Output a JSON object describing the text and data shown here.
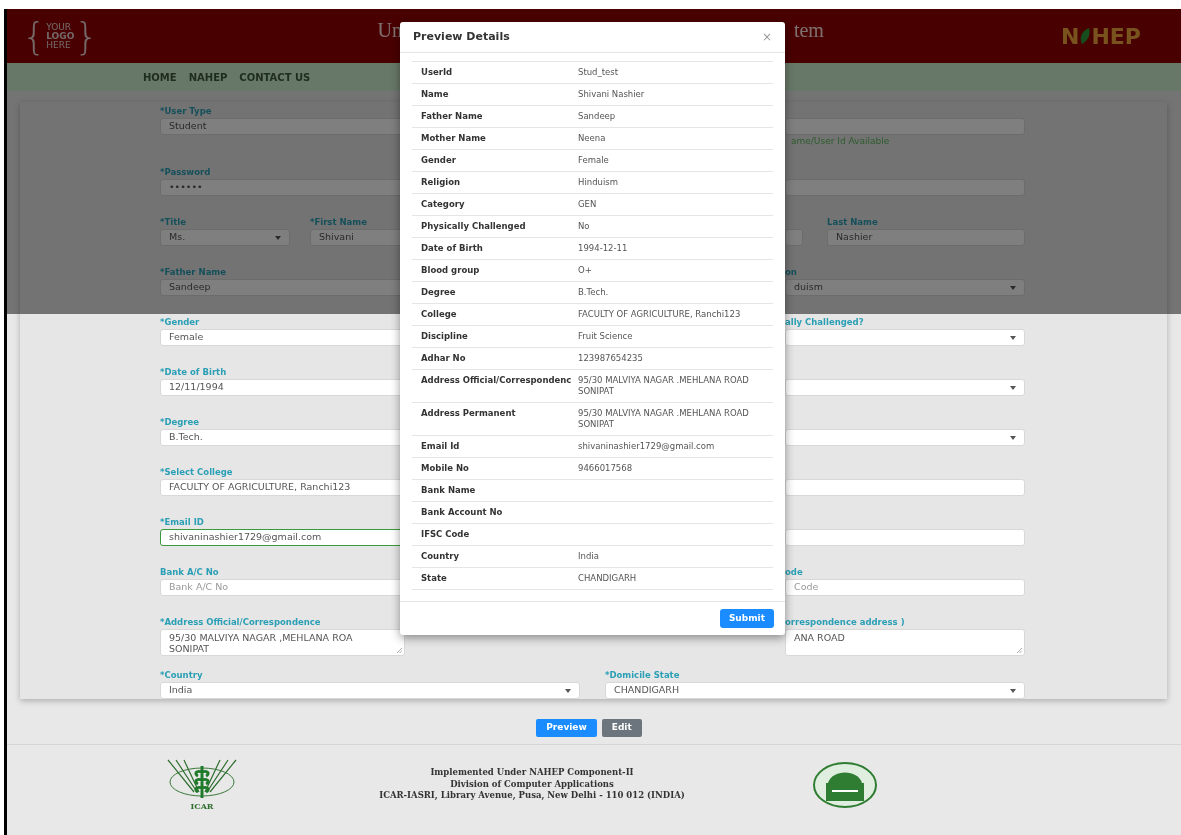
{
  "header": {
    "logo": {
      "open": "{",
      "lines": [
        "YOUR",
        "LOGO",
        "HERE"
      ],
      "close": "}"
    },
    "title_parts": [
      "Un",
      "tem"
    ],
    "brand": [
      "N",
      "HEP"
    ]
  },
  "nav": [
    "HOME",
    "NAHEP",
    "CONTACT US"
  ],
  "form": {
    "rows": [
      {
        "kind": "split",
        "left": [
          {
            "kind": "input",
            "label": "*User Type",
            "value": "Student",
            "valid": false
          }
        ],
        "right": [
          {
            "kind": "input",
            "valid": false,
            "note": "ame/User Id Available"
          }
        ]
      },
      {
        "kind": "split",
        "left": [
          {
            "kind": "input",
            "label": "*Password",
            "value": "••••••",
            "valid": false
          }
        ],
        "right": [
          {
            "kind": "input",
            "valid": false
          }
        ]
      },
      {
        "kind": "split",
        "left": [
          {
            "kind": "select",
            "label": "*Title",
            "value": "Ms.",
            "valid": false
          },
          {
            "kind": "input",
            "label": "*First Name",
            "value": "Shivani",
            "valid": false
          }
        ],
        "right": [
          {
            "kind": "input",
            "valid": false
          },
          {
            "kind": "input",
            "label": "Last Name",
            "value": "Nashier",
            "valid": false
          }
        ]
      },
      {
        "kind": "split",
        "left": [
          {
            "kind": "input",
            "label": "*Father Name",
            "value": "Sandeep",
            "valid": false
          }
        ],
        "right": [
          {
            "kind": "select",
            "label": "on",
            "value": "duism",
            "valid": false
          }
        ]
      },
      {
        "kind": "split",
        "left": [
          {
            "kind": "input",
            "label": "*Gender",
            "value": "Female",
            "valid": false
          }
        ],
        "right": [
          {
            "kind": "select",
            "label": "ally Challenged?",
            "valid": false
          }
        ]
      },
      {
        "kind": "split",
        "left": [
          {
            "kind": "input",
            "label": "*Date of Birth",
            "value": "12/11/1994",
            "valid": false
          }
        ],
        "right": [
          {
            "kind": "select",
            "valid": false
          }
        ]
      },
      {
        "kind": "split",
        "left": [
          {
            "kind": "input",
            "label": "*Degree",
            "value": "B.Tech.",
            "valid": false
          }
        ],
        "right": [
          {
            "kind": "select",
            "valid": false
          }
        ]
      },
      {
        "kind": "split",
        "left": [
          {
            "kind": "input",
            "label": "*Select College",
            "value": "FACULTY OF AGRICULTURE, Ranchi123",
            "valid": false
          }
        ],
        "right": [
          {
            "kind": "input",
            "valid": false
          }
        ]
      },
      {
        "kind": "split",
        "left": [
          {
            "kind": "input",
            "label": "*Email ID",
            "value": "shivaninashier1729@gmail.com",
            "valid": true
          }
        ],
        "right": [
          {
            "kind": "input",
            "valid": false
          }
        ]
      },
      {
        "kind": "split",
        "left": [
          {
            "kind": "input",
            "label": "Bank A/C No",
            "placeholder": "Bank A/C No",
            "valid": false
          }
        ],
        "right": [
          {
            "kind": "input",
            "label": "ode",
            "placeholder": "Code",
            "valid": false
          }
        ]
      },
      {
        "kind": "split",
        "left": [
          {
            "kind": "textarea",
            "label": "*Address Official/Correspondence",
            "value": "95/30 MALVIYA NAGAR ,MEHLANA ROA\nSONIPAT",
            "valid": false
          }
        ],
        "right": [
          {
            "kind": "textarea",
            "label": "orrespondence address )",
            "value": "ANA ROAD",
            "valid": false
          }
        ]
      },
      {
        "kind": "full",
        "left": [
          {
            "kind": "select",
            "label": "*Country",
            "value": "India",
            "valid": false
          }
        ],
        "right": [
          {
            "kind": "select",
            "label": "*Domicile State",
            "value": "CHANDIGARH",
            "valid": false
          }
        ]
      }
    ]
  },
  "buttons": [
    {
      "label": "Preview",
      "kind": "primary"
    },
    {
      "label": "Edit",
      "kind": "secondary"
    }
  ],
  "footer": {
    "logo_text": "ICAR",
    "lines": [
      "Implemented Under NAHEP Component-II",
      "Division of Computer Applications",
      "ICAR-IASRI, Library Avenue, Pusa, New Delhi - 110 012 (INDIA)"
    ]
  },
  "modal": {
    "title": "Preview Details",
    "close": "×",
    "rows": [
      {
        "label": "UserId",
        "value": "Stud_test"
      },
      {
        "label": "Name",
        "value": "Shivani Nashier"
      },
      {
        "label": "Father Name",
        "value": "Sandeep"
      },
      {
        "label": "Mother Name",
        "value": "Neena"
      },
      {
        "label": "Gender",
        "value": "Female"
      },
      {
        "label": "Religion",
        "value": "Hinduism"
      },
      {
        "label": "Category",
        "value": "GEN"
      },
      {
        "label": "Physically Challenged",
        "value": "No"
      },
      {
        "label": "Date of Birth",
        "value": "1994-12-11"
      },
      {
        "label": "Blood group",
        "value": "O+"
      },
      {
        "label": "Degree",
        "value": "B.Tech."
      },
      {
        "label": "College",
        "value": "FACULTY OF AGRICULTURE, Ranchi123"
      },
      {
        "label": "Discipline",
        "value": "Fruit Science"
      },
      {
        "label": "Adhar No",
        "value": "123987654235"
      },
      {
        "label": "Address Official/Correspondenc",
        "value": "95/30 MALVIYA NAGAR .MEHLANA ROAD SONIPAT"
      },
      {
        "label": "Address Permanent",
        "value": "95/30 MALVIYA NAGAR .MEHLANA ROAD SONIPAT"
      },
      {
        "label": "Email Id",
        "value": "shivaninashier1729@gmail.com"
      },
      {
        "label": "Mobile No",
        "value": "9466017568"
      },
      {
        "label": "Bank Name"
      },
      {
        "label": "Bank Account No"
      },
      {
        "label": "IFSC Code"
      },
      {
        "label": "Country",
        "value": "India"
      },
      {
        "label": "State",
        "value": "CHANDIGARH"
      }
    ],
    "submit": "Submit"
  }
}
